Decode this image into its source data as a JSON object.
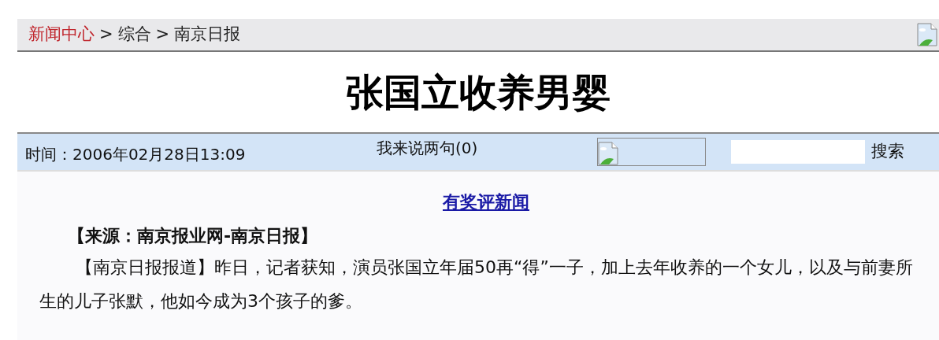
{
  "breadcrumb": [
    {
      "label": "新闻中心",
      "kind": "link"
    },
    {
      "label": ">",
      "kind": "separator"
    },
    {
      "label": "综合",
      "kind": "text"
    },
    {
      "label": ">",
      "kind": "separator"
    },
    {
      "label": "南京日报",
      "kind": "text"
    }
  ],
  "headline": "张国立收养男婴",
  "info_bar": {
    "time": "时间：2006年02月28日13:09",
    "comments_link": "我来说两句(0)",
    "search_button": "搜索"
  },
  "promo_link": "有奖评新闻",
  "source": "【来源：南京报业网-南京日报】",
  "paragraphs": [
    "【南京日报报道】昨日，记者获知，演员张国立年届50再“得”一子，加上去年收养的一个女儿，以及与前妻所生的儿子张默，他如今成为3个孩子的爹。"
  ]
}
